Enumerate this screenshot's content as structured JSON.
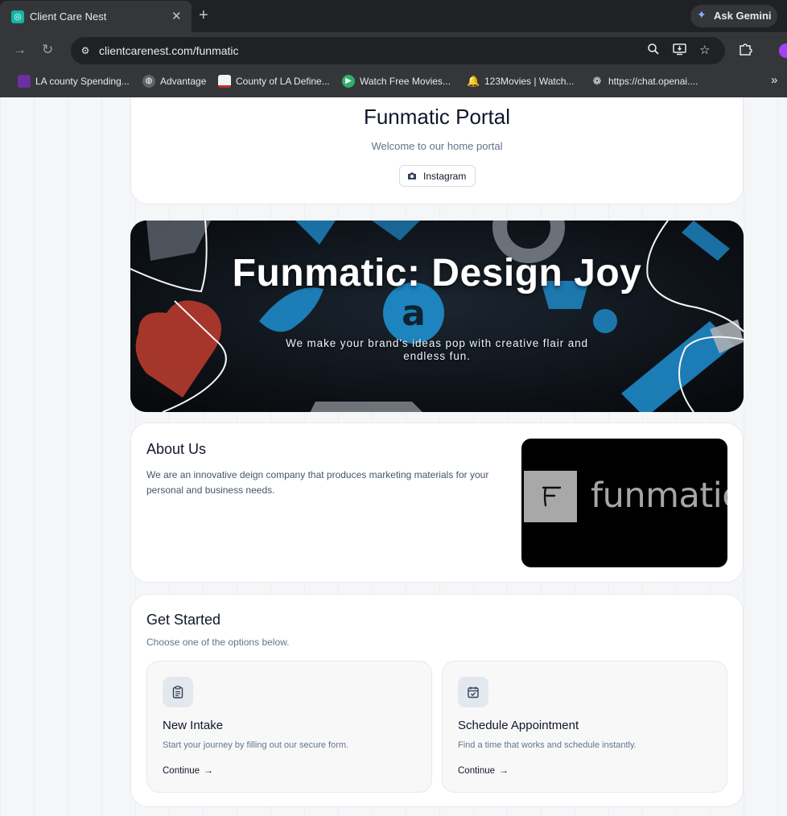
{
  "browser": {
    "tab": {
      "title": "Client Care Nest",
      "close_glyph": "✕"
    },
    "new_tab_glyph": "+",
    "gemini_label": "Ask Gemini",
    "url": "clientcarenest.com/funmatic",
    "bookmarks": [
      {
        "label": "LA county Spending...",
        "icon": "purple-square-icon",
        "color": "#6b2fa0"
      },
      {
        "label": "Advantage",
        "icon": "globe-icon",
        "color": "#5f6368"
      },
      {
        "label": "County of LA Define...",
        "icon": "county-seal-icon",
        "color": "#c62828"
      },
      {
        "label": "Watch Free Movies...",
        "icon": "play-icon",
        "color": "#2eaf6a"
      },
      {
        "label": "123Movies | Watch...",
        "icon": "bell-icon",
        "color": "#4f8ef7"
      },
      {
        "label": "https://chat.openai....",
        "icon": "openai-icon",
        "color": "#5f6368"
      }
    ]
  },
  "header": {
    "title": "Funmatic Portal",
    "subtitle": "Welcome to our home portal",
    "instagram_label": "Instagram"
  },
  "hero": {
    "title": "Funmatic: Design Joy",
    "subtitle": "We make your brand's ideas pop with creative flair and endless fun."
  },
  "about": {
    "title": "About Us",
    "text": "We are an innovative deign company that produces marketing materials for your personal and business needs.",
    "logo_word": "funmatic"
  },
  "get_started": {
    "title": "Get Started",
    "subtitle": "Choose one of the options below.",
    "options": [
      {
        "title": "New Intake",
        "desc": "Start your journey by filling out our secure form.",
        "link": "Continue"
      },
      {
        "title": "Schedule Appointment",
        "desc": "Find a time that works and schedule instantly.",
        "link": "Continue"
      }
    ]
  },
  "colors": {
    "chrome_dark": "#202124",
    "chrome_toolbar": "#35363a",
    "hero_blue": "#1e88c7",
    "hero_red": "#c0392b"
  }
}
